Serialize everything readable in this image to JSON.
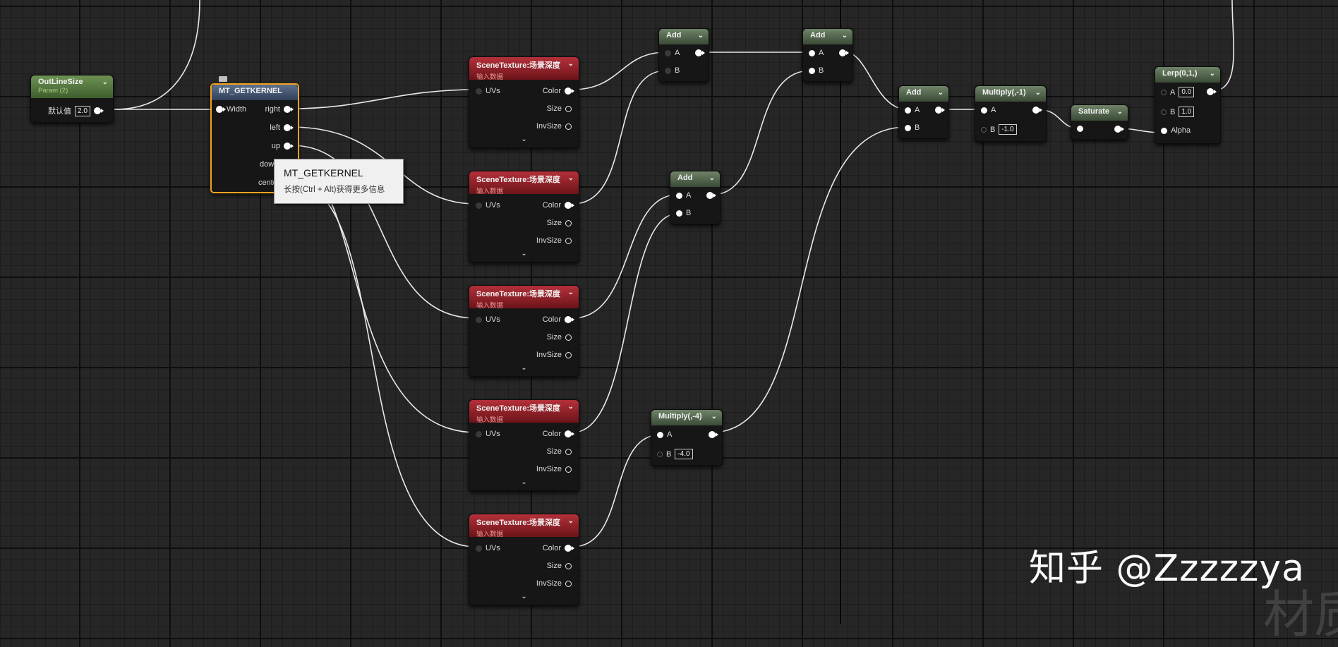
{
  "nodes": {
    "outline_size": {
      "title": "OutLineSize",
      "subtitle": "Param (2)",
      "default_label": "默认值",
      "default_value": "2.0"
    },
    "getkernel": {
      "title": "MT_GETKERNEL",
      "pins": [
        "Width",
        "right",
        "left",
        "up",
        "dow",
        "cente"
      ]
    },
    "scene_texture": {
      "title": "SceneTexture:场景深度",
      "subtitle": "输入数据",
      "uvs": "UVs",
      "color": "Color",
      "size": "Size",
      "invsize": "InvSize",
      "expand": "⌄"
    },
    "add": {
      "title": "Add",
      "a": "A",
      "b": "B"
    },
    "multiply_neg4": {
      "title": "Multiply(,-4)",
      "a": "A",
      "b": "B",
      "b_value": "-4.0"
    },
    "multiply_neg1": {
      "title": "Multiply(,-1)",
      "a": "A",
      "b": "B",
      "b_value": "-1.0"
    },
    "saturate": {
      "title": "Saturate"
    },
    "lerp": {
      "title": "Lerp(0,1,)",
      "a": "A",
      "a_value": "0.0",
      "b": "B",
      "b_value": "1.0",
      "alpha": "Alpha"
    },
    "chevron": "⌄"
  },
  "tooltip": {
    "title": "MT_GETKERNEL",
    "hint": "长按(Ctrl + Alt)获得更多信息"
  },
  "watermark": "知乎 @Zzzzzya",
  "corner_text": "材质",
  "colors": {
    "param_header": "#5e8a48",
    "function_header": "#4c5f7d",
    "texture_header": "#a3222c",
    "math_header": "#586b52",
    "selection": "#f0a31f",
    "wire": "#e9e9e9"
  }
}
